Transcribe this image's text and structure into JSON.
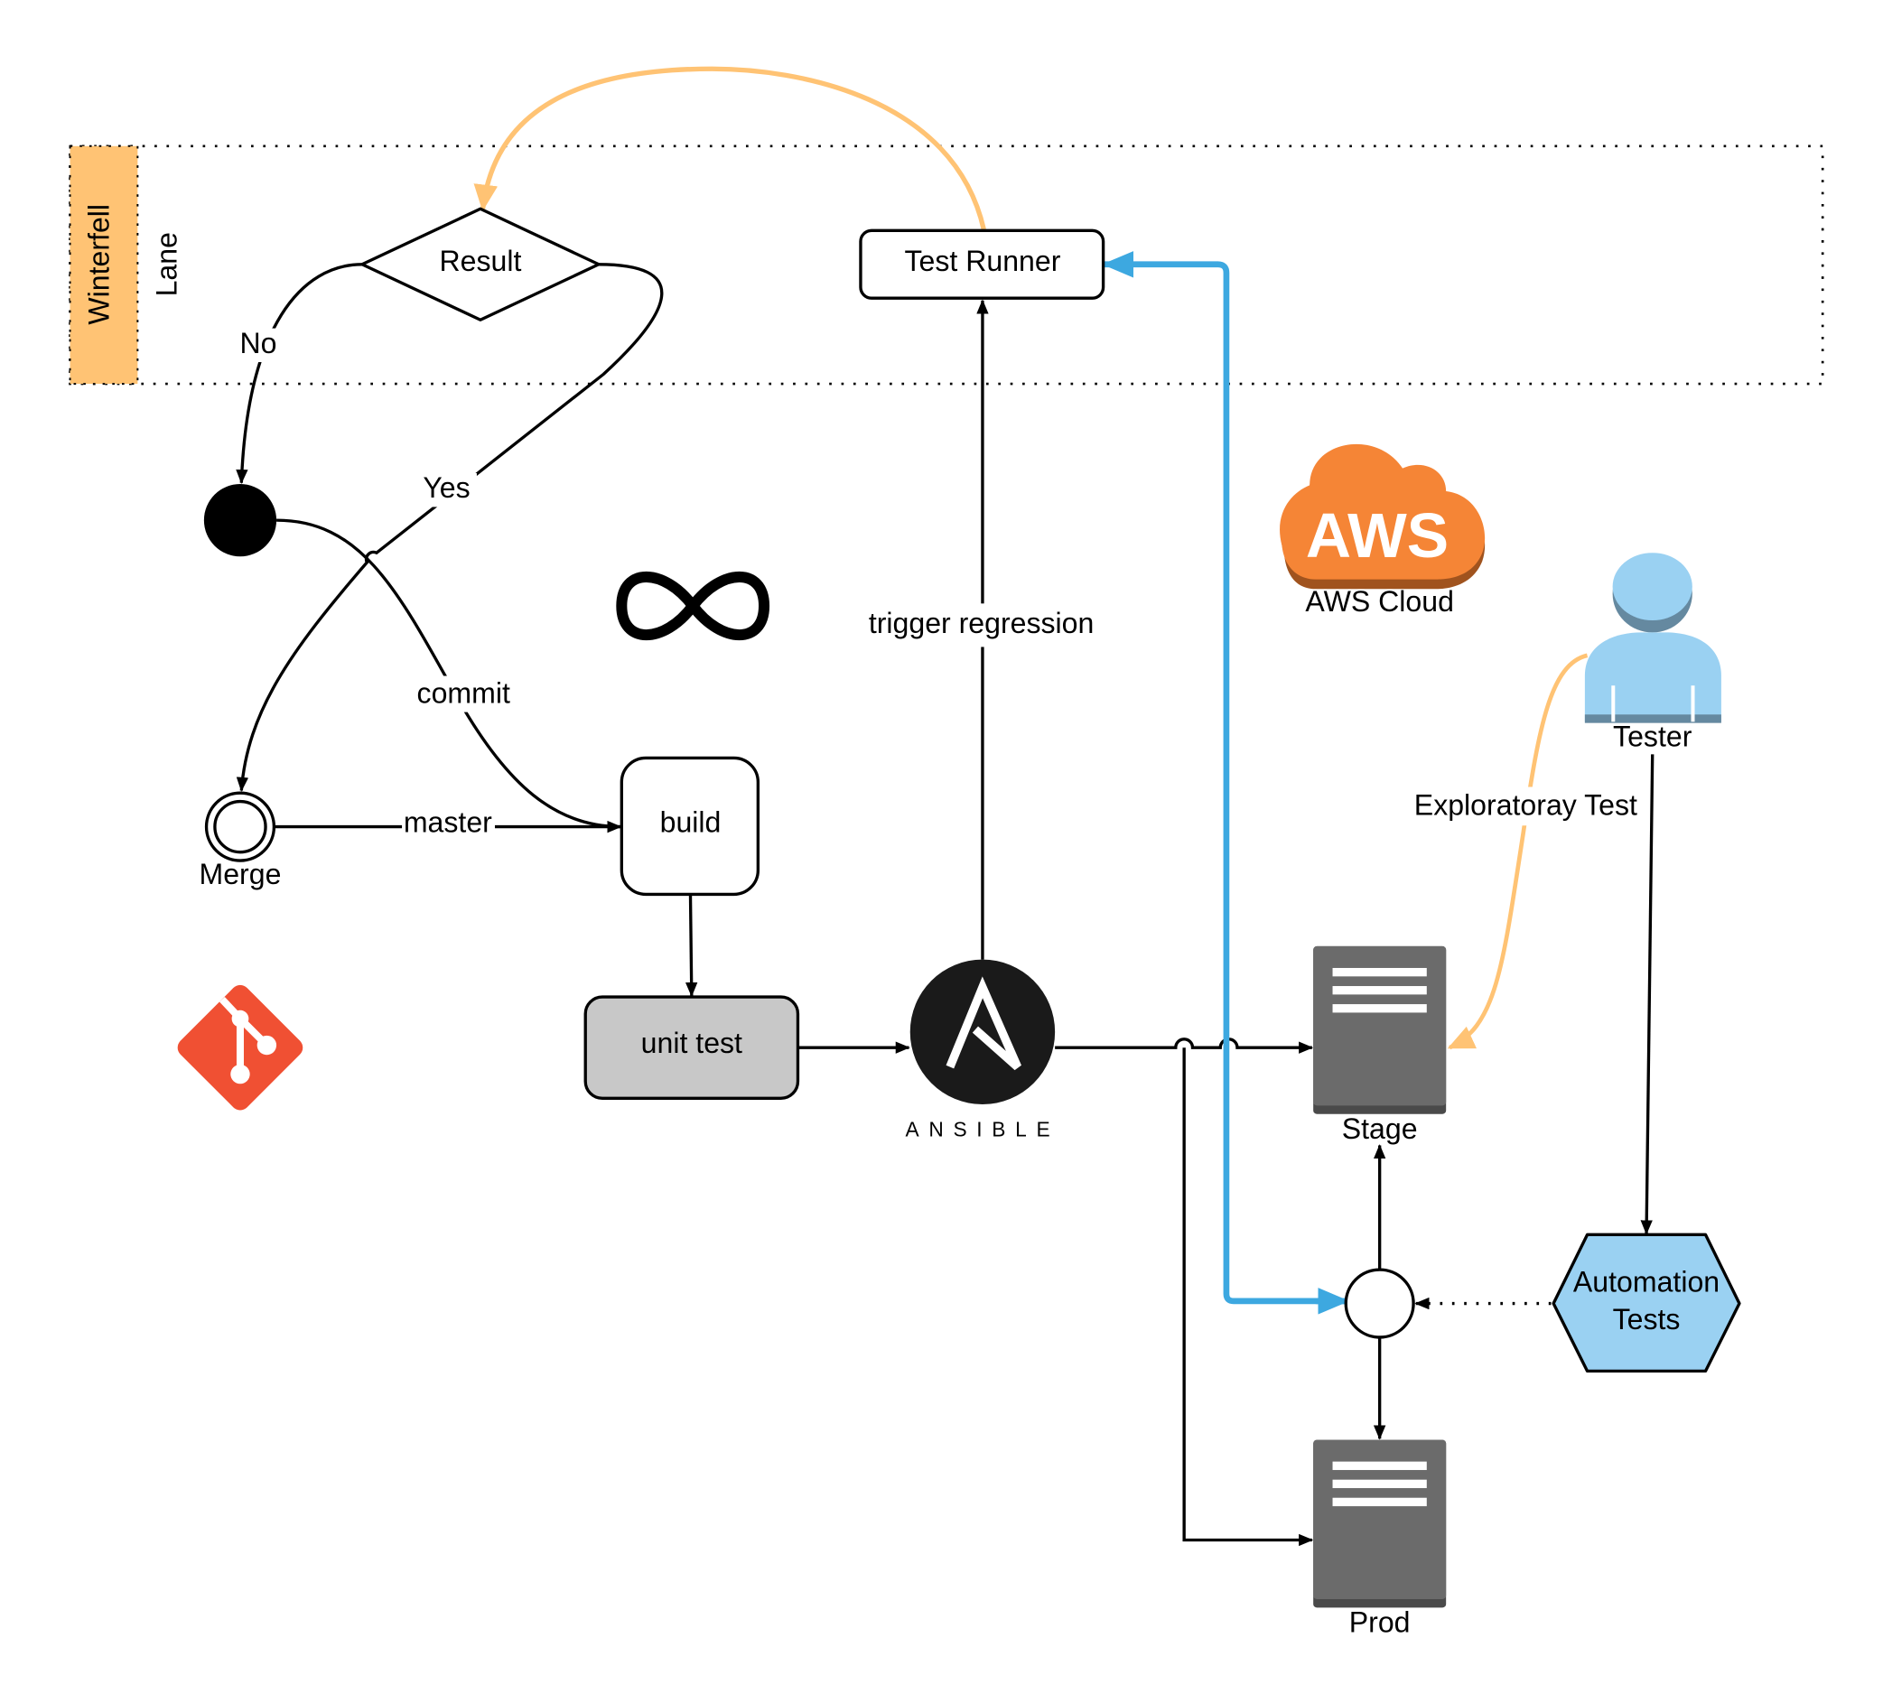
{
  "colors": {
    "lane_header": "#FFC374",
    "orange_edge": "#FFC374",
    "blue_edge": "#3DA8E0",
    "server": "#6B6B6B",
    "unit_test_fill": "#C8C8C8",
    "aws_orange": "#F58536",
    "aws_shadow": "#A0531E",
    "tester_blue": "#9AD1F2",
    "tester_shadow": "#6589A0",
    "automation_fill": "#9AD1F2",
    "git_red": "#F05033"
  },
  "lane": {
    "header": "Winterfell",
    "label": "Lane"
  },
  "nodes": {
    "result": "Result",
    "test_runner": "Test Runner",
    "merge": "Merge",
    "build": "build",
    "unit_test": "unit test",
    "ansible": "ANSIBLE",
    "aws_logo": "AWS",
    "aws": "AWS Cloud",
    "tester": "Tester",
    "stage": "Stage",
    "prod": "Prod",
    "automation_line1": "Automation",
    "automation_line2": "Tests"
  },
  "edges": {
    "no": "No",
    "yes": "Yes",
    "commit": "commit",
    "master": "master",
    "trigger": "trigger regression",
    "exploratory": "Exploratoray Test"
  },
  "icons": [
    "infinity-icon",
    "git-icon",
    "ansible-logo",
    "aws-cloud-icon",
    "user-icon",
    "server-icon"
  ]
}
